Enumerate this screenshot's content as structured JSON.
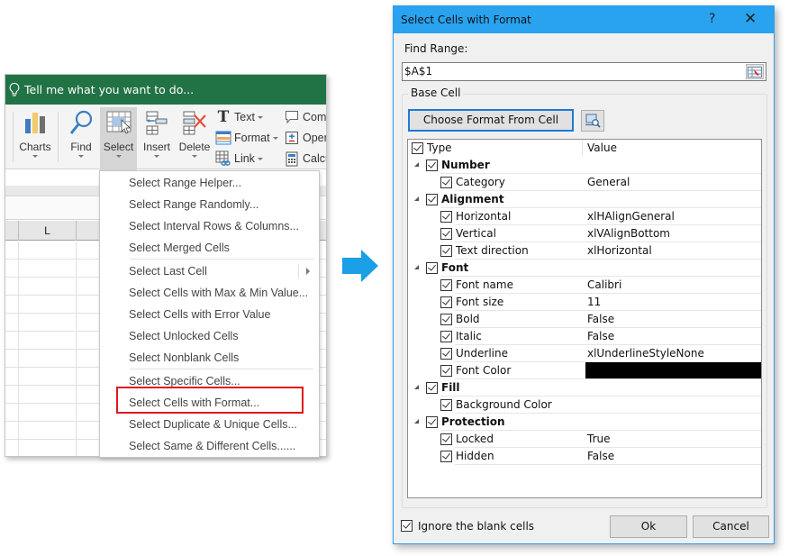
{
  "excel": {
    "tell_me": "Tell me what you want to do...",
    "ribbon": {
      "large_buttons": [
        {
          "label": "Charts",
          "icon": "bar-chart-icon"
        },
        {
          "label": "Find",
          "icon": "magnifier-icon"
        },
        {
          "label": "Select",
          "icon": "select-grid-icon",
          "active": true
        },
        {
          "label": "Insert",
          "icon": "insert-cells-icon"
        },
        {
          "label": "Delete",
          "icon": "delete-cells-icon"
        }
      ],
      "small_buttons": [
        {
          "label": "Text",
          "icon": "text-icon",
          "dropdown": true
        },
        {
          "label": "Format",
          "icon": "format-icon",
          "dropdown": true
        },
        {
          "label": "Link",
          "icon": "link-icon",
          "dropdown": true
        },
        {
          "label": "Comm",
          "icon": "comment-icon"
        },
        {
          "label": "Opera",
          "icon": "operation-icon"
        },
        {
          "label": "Calcu",
          "icon": "calculator-icon"
        }
      ]
    },
    "column_header": "L",
    "select_menu": {
      "items": [
        {
          "label": "Select Range Helper..."
        },
        {
          "label": "Select Range Randomly..."
        },
        {
          "label": "Select Interval Rows & Columns..."
        },
        {
          "label": "Select Merged Cells"
        },
        {
          "label": "Select Last Cell",
          "submenu": true
        },
        {
          "label": "Select Cells with Max & Min Value..."
        },
        {
          "label": "Select Cells with Error Value"
        },
        {
          "label": "Select Unlocked Cells"
        },
        {
          "label": "Select Nonblank Cells"
        },
        {
          "label": "Select Specific Cells..."
        },
        {
          "label": "Select Cells with Format...",
          "highlighted": true
        },
        {
          "label": "Select Duplicate & Unique Cells..."
        },
        {
          "label": "Select Same & Different Cells......"
        }
      ]
    }
  },
  "arrow": {
    "icon": "right-arrow-icon",
    "color": "#1b9fe6"
  },
  "dialog": {
    "title": "Select Cells with Format",
    "help": "?",
    "close": "✕",
    "find_range_label": "Find Range:",
    "find_range_value": "$A$1",
    "base_cell_label": "Base Cell",
    "choose_button": "Choose Format From Cell",
    "tree_header": {
      "type": "Type",
      "value": "Value",
      "checked": true
    },
    "tree": [
      {
        "label": "Number",
        "group": true,
        "checked": true
      },
      {
        "label": "Category",
        "value": "General",
        "checked": true
      },
      {
        "label": "Alignment",
        "group": true,
        "checked": true
      },
      {
        "label": "Horizontal",
        "value": "xlHAlignGeneral",
        "checked": true
      },
      {
        "label": "Vertical",
        "value": "xlVAlignBottom",
        "checked": true
      },
      {
        "label": "Text direction",
        "value": "xlHorizontal",
        "checked": true
      },
      {
        "label": "Font",
        "group": true,
        "checked": true
      },
      {
        "label": "Font name",
        "value": "Calibri",
        "checked": true
      },
      {
        "label": "Font size",
        "value": "11",
        "checked": true
      },
      {
        "label": "Bold",
        "value": "False",
        "checked": true
      },
      {
        "label": "Italic",
        "value": "False",
        "checked": true
      },
      {
        "label": "Underline",
        "value": "xlUnderlineStyleNone",
        "checked": true
      },
      {
        "label": "Font Color",
        "value": "",
        "swatch": "#000000",
        "checked": true
      },
      {
        "label": "Fill",
        "group": true,
        "checked": true
      },
      {
        "label": "Background Color",
        "value": "",
        "checked": true
      },
      {
        "label": "Protection",
        "group": true,
        "checked": true
      },
      {
        "label": "Locked",
        "value": "True",
        "checked": true
      },
      {
        "label": "Hidden",
        "value": "False",
        "checked": true
      }
    ],
    "ignore_blank_label": "Ignore the blank cells",
    "ignore_blank_checked": true,
    "ok_label": "Ok",
    "cancel_label": "Cancel"
  }
}
